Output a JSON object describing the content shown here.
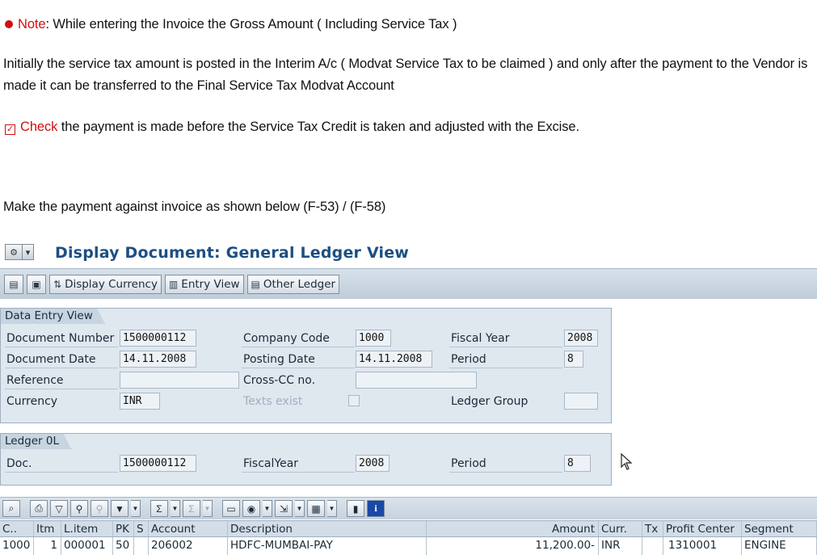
{
  "intro": {
    "note_label": "Note",
    "note_text": ": While entering the Invoice the Gross Amount ( Including Service Tax )",
    "paragraph": "Initially the service tax amount is posted in the Interim A/c ( Modvat Service Tax to be claimed ) and only after the payment to the Vendor is made it can be transferred to the Final Service Tax Modvat Account",
    "check_label": "Check",
    "check_text": " the payment is made before the Service Tax Credit is taken and adjusted with the Excise.",
    "instruction": "Make the payment against invoice as shown below (F-53) / (F-58)"
  },
  "window": {
    "title": "Display Document: General Ledger View"
  },
  "toolbar": {
    "display_currency": "Display Currency",
    "entry_view": "Entry View",
    "other_ledger": "Other Ledger"
  },
  "data_entry_view": {
    "title": "Data Entry View",
    "document_number_label": "Document Number",
    "document_number": "1500000112",
    "company_code_label": "Company Code",
    "company_code": "1000",
    "fiscal_year_label": "Fiscal Year",
    "fiscal_year": "2008",
    "document_date_label": "Document Date",
    "document_date": "14.11.2008",
    "posting_date_label": "Posting Date",
    "posting_date": "14.11.2008",
    "period_label": "Period",
    "period": "8",
    "reference_label": "Reference",
    "reference": "",
    "cross_cc_label": "Cross-CC no.",
    "cross_cc": "",
    "currency_label": "Currency",
    "currency": "INR",
    "texts_exist_label": "Texts exist",
    "ledger_group_label": "Ledger Group",
    "ledger_group": ""
  },
  "ledger": {
    "title": "Ledger 0L",
    "doc_label": "Doc.",
    "doc": "1500000112",
    "fiscal_year_label": "FiscalYear",
    "fiscal_year": "2008",
    "period_label": "Period",
    "period": "8"
  },
  "table": {
    "columns": [
      "C..",
      "Itm",
      "L.item",
      "PK",
      "S",
      "Account",
      "Description",
      "Amount",
      "Curr.",
      "Tx",
      "Profit Center",
      "Segment"
    ],
    "rows": [
      [
        "1000",
        "1",
        "000001",
        "50",
        "",
        "206002",
        "HDFC-MUMBAI-PAY",
        "11,200.00-",
        "INR",
        "",
        "1310001",
        "ENGINE"
      ]
    ]
  },
  "colors": {
    "accent_red": "#d01010",
    "title_blue": "#1c4f82",
    "group_bg": "#dfe7ef",
    "toolbar_bg": "#c9d5e1"
  }
}
